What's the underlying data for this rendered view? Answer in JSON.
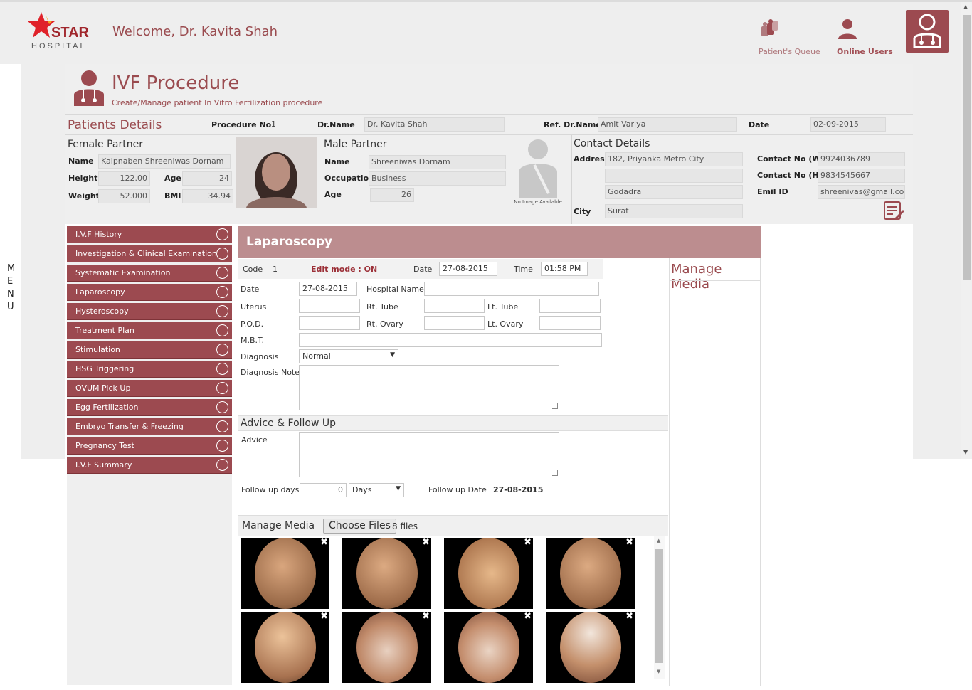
{
  "header": {
    "logo_text": "STAR",
    "logo_sub": "HOSPITAL",
    "welcome": "Welcome, Dr. Kavita Shah",
    "patients_queue_label": "Patient's Queue",
    "online_users_label": "Online Users"
  },
  "menu_letters": [
    "M",
    "E",
    "N",
    "U"
  ],
  "page": {
    "title": "IVF Procedure",
    "subtitle": "Create/Manage patient In Vitro Fertilization procedure"
  },
  "patient_details": {
    "heading": "Patients Details",
    "procedure_no_label": "Procedure No.",
    "procedure_no": "1",
    "dr_name_label": "Dr.Name",
    "dr_name": "Dr. Kavita Shah",
    "ref_dr_label": "Ref. Dr.Name",
    "ref_dr": "Amit Variya",
    "date_label": "Date",
    "date": "02-09-2015"
  },
  "female": {
    "heading": "Female Partner",
    "name_label": "Name",
    "name": "Kalpnaben Shreeniwas Dornam",
    "height_label": "Height",
    "height": "122.00",
    "age_label": "Age",
    "age": "24",
    "weight_label": "Weight",
    "weight": "52.000",
    "bmi_label": "BMI",
    "bmi": "34.94"
  },
  "male": {
    "heading": "Male Partner",
    "name_label": "Name",
    "name": "Shreeniwas Dornam",
    "occupation_label": "Occupation",
    "occupation": "Business",
    "age_label": "Age",
    "age": "26",
    "no_image": "No Image Available"
  },
  "contact": {
    "heading": "Contact Details",
    "address_label": "Address",
    "address1": "182, Priyanka Metro City",
    "address2": "",
    "address3": "Godadra",
    "city_label": "City",
    "city": "Surat",
    "work_label": "Contact No (W)",
    "work": "9924036789",
    "home_label": "Contact No (H)",
    "home": "9834545667",
    "email_label": "Emil ID",
    "email": "shreenivas@gmail.com"
  },
  "sidebar": {
    "items": [
      "I.V.F History",
      "Investigation & Clinical Examination",
      "Systematic Examination",
      "Laparoscopy",
      "Hysteroscopy",
      "Treatment Plan",
      "Stimulation",
      "HSG Triggering",
      "OVUM Pick Up",
      "Egg Fertilization",
      "Embryo Transfer & Freezing",
      "Pregnancy Test",
      "I.V.F Summary"
    ]
  },
  "form": {
    "section_title": "Laparoscopy",
    "code_label": "Code",
    "code": "1",
    "edit_mode": "Edit mode : ON",
    "date_label": "Date",
    "date": "27-08-2015",
    "time_label": "Time",
    "time": "01:58 PM",
    "date2_label": "Date",
    "date2": "27-08-2015",
    "hospital_label": "Hospital Name",
    "hospital": "",
    "uterus_label": "Uterus",
    "rt_tube_label": "Rt. Tube",
    "lt_tube_label": "Lt. Tube",
    "pod_label": "P.O.D.",
    "rt_ovary_label": "Rt. Ovary",
    "lt_ovary_label": "Lt. Ovary",
    "mbt_label": "M.B.T.",
    "diagnosis_label": "Diagnosis",
    "diagnosis": "Normal",
    "diagnosis_note_label": "Diagnosis Note",
    "advice_heading": "Advice & Follow Up",
    "advice_label": "Advice",
    "followup_days_label": "Follow up days",
    "followup_days": "0",
    "followup_unit": "Days",
    "followup_date_label": "Follow up Date",
    "followup_date": "27-08-2015",
    "media_heading": "Manage Media",
    "choose_files": "Choose Files",
    "files_count": "8 files"
  },
  "media_panel_heading": "Manage Media",
  "colors": {
    "brand": "#9c4a50",
    "header_bg": "#eeeeee",
    "section_head": "#bc8d8f"
  }
}
